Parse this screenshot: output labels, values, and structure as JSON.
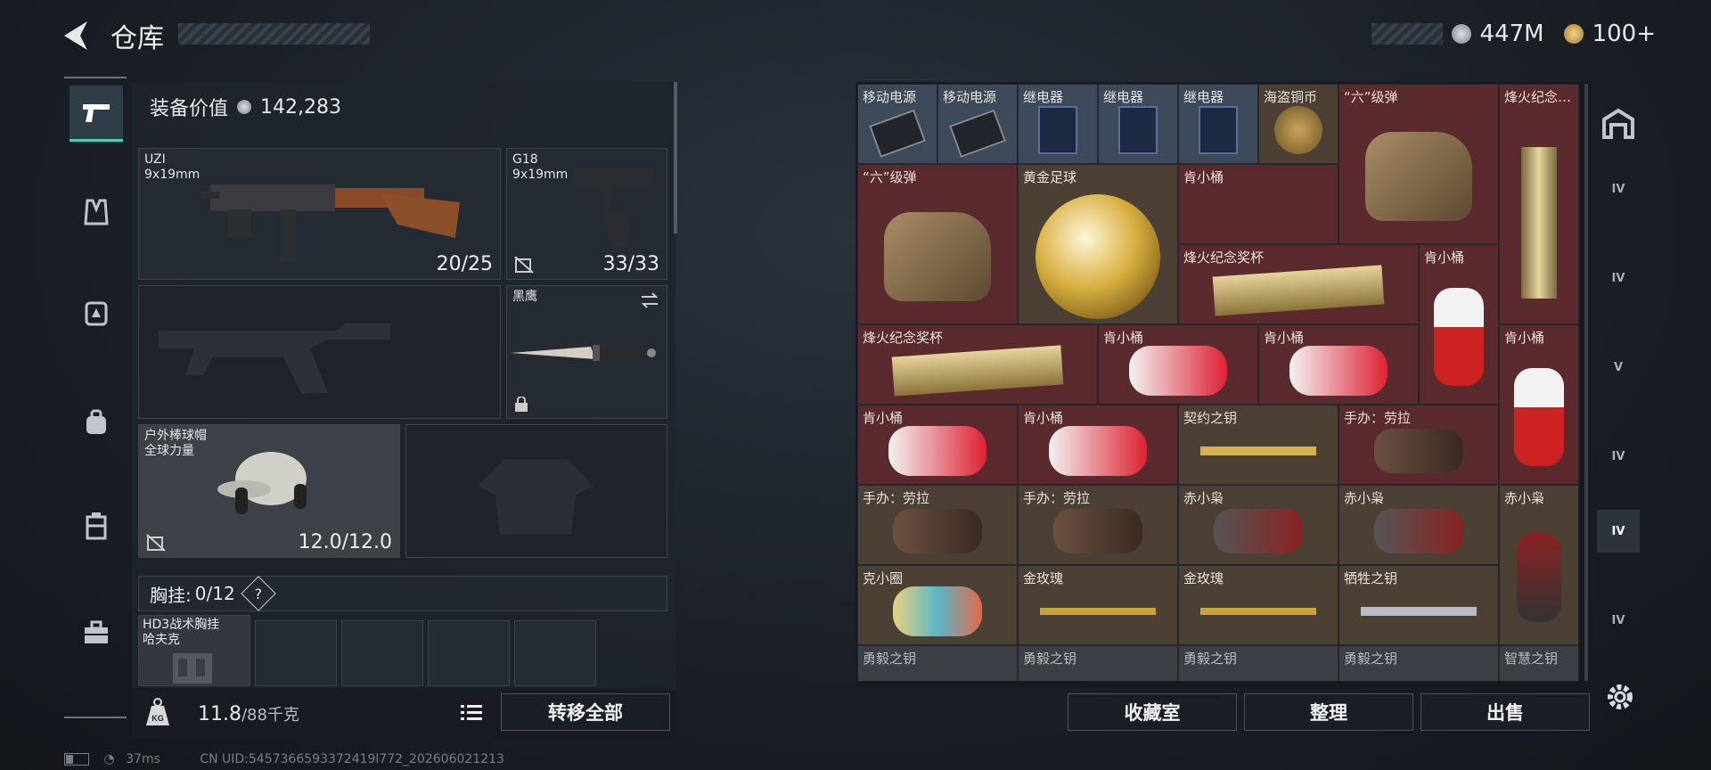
{
  "header": {
    "title": "仓库",
    "currency_a": "447M",
    "currency_b": "100+"
  },
  "loadout": {
    "equip_value_label": "装备价值",
    "equip_value": "142,283",
    "slots": [
      {
        "name": "UZI",
        "sub": "9x19mm",
        "count": "20/25"
      },
      {
        "name": "G18",
        "sub": "9x19mm",
        "count": "33/33"
      },
      {
        "name": "",
        "sub": "",
        "count": ""
      },
      {
        "name": "黑鹰",
        "sub": "",
        "count": ""
      },
      {
        "name": "户外棒球帽",
        "sub": "全球力量",
        "count": "12.0/12.0"
      },
      {
        "name": "",
        "sub": "",
        "count": ""
      }
    ],
    "chest_label": "胸挂:",
    "chest_value": "0/12",
    "chest_help": "?",
    "chest_item_name": "HD3战术胸挂",
    "chest_item_sub": "哈夫克",
    "weight": "11.8",
    "weight_max": "/88千克",
    "transfer_all": "转移全部"
  },
  "status": {
    "ping": "37ms",
    "uid": "CN UID:5457366593372419l772_202606021213"
  },
  "storage": {
    "cells": [
      {
        "label": "移动电源",
        "color": "blue"
      },
      {
        "label": "移动电源",
        "color": "blue"
      },
      {
        "label": "继电器",
        "color": "blue"
      },
      {
        "label": "继电器",
        "color": "blue"
      },
      {
        "label": "继电器",
        "color": "blue"
      },
      {
        "label": "海盗铜币",
        "color": "gold"
      },
      {
        "label": "“六”级弹",
        "color": "red"
      },
      {
        "label": "烽火纪念…",
        "color": "red"
      },
      {
        "label": "“六”级弹",
        "color": "red"
      },
      {
        "label": "黄金足球",
        "color": "gold"
      },
      {
        "label": "肯小桶",
        "color": "red"
      },
      {
        "label": "烽火纪念奖杯",
        "color": "red"
      },
      {
        "label": "肯小桶",
        "color": "red"
      },
      {
        "label": "烽火纪念奖杯",
        "color": "red"
      },
      {
        "label": "肯小桶",
        "color": "red"
      },
      {
        "label": "肯小桶",
        "color": "red"
      },
      {
        "label": "肯小桶",
        "color": "red"
      },
      {
        "label": "肯小桶",
        "color": "red"
      },
      {
        "label": "肯小桶",
        "color": "red"
      },
      {
        "label": "契约之钥",
        "color": "gold"
      },
      {
        "label": "手办：劳拉",
        "color": "red"
      },
      {
        "label": "手办：劳拉",
        "color": "gold"
      },
      {
        "label": "手办：劳拉",
        "color": "gold"
      },
      {
        "label": "赤小枭",
        "color": "gold"
      },
      {
        "label": "赤小枭",
        "color": "gold"
      },
      {
        "label": "赤小枭",
        "color": "gold"
      },
      {
        "label": "克小圈",
        "color": "gold"
      },
      {
        "label": "金玫瑰",
        "color": "gold"
      },
      {
        "label": "金玫瑰",
        "color": "gold"
      },
      {
        "label": "牺牲之钥",
        "color": "gold"
      },
      {
        "label": "勇毅之钥",
        "color": "gray"
      },
      {
        "label": "勇毅之钥",
        "color": "gray"
      },
      {
        "label": "勇毅之钥",
        "color": "gray"
      },
      {
        "label": "勇毅之钥",
        "color": "gray"
      },
      {
        "label": "智慧之钥",
        "color": "gray"
      }
    ],
    "buttons": {
      "collection": "收藏室",
      "organize": "整理",
      "sell": "出售"
    }
  },
  "right_tabs": [
    "IV",
    "IV",
    "V",
    "IV",
    "IV",
    "IV"
  ],
  "colors": {
    "accent": "#47d2b0",
    "red_cell": "#5a2a2e",
    "gold_cell": "#4c4034",
    "blue_cell": "#3c4a5c"
  }
}
